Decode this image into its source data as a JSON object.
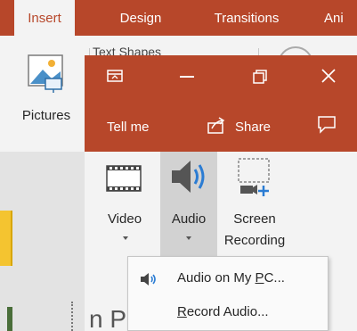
{
  "tabs": [
    "Insert",
    "Design",
    "Transitions",
    "Ani"
  ],
  "ribbon": {
    "pictures_label": "Pictures",
    "shapes_partial": "Text Shapes",
    "video_label": "Video",
    "audio_label": "Audio",
    "screen_recording_line1": "Screen",
    "screen_recording_line2": "Recording"
  },
  "overlay": {
    "tell_me": "Tell me",
    "share": "Share"
  },
  "menu": {
    "items": [
      {
        "pre": "Audio on My ",
        "ul": "P",
        "post": "C..."
      },
      {
        "pre": "",
        "ul": "R",
        "post": "ecord Audio..."
      }
    ]
  },
  "bottom_text": "n P"
}
